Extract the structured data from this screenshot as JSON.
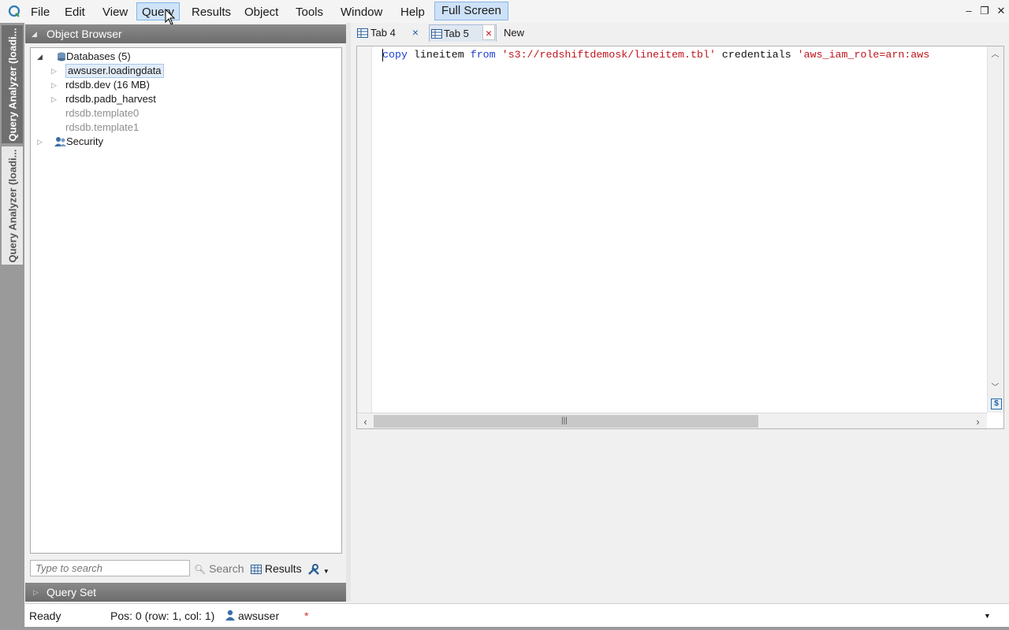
{
  "menu": {
    "items": [
      "File",
      "Edit",
      "View",
      "Query",
      "Results",
      "Object",
      "Tools",
      "Window",
      "Help"
    ],
    "active_index": 3,
    "fullscreen_label": "Full Screen"
  },
  "window_controls": {
    "minimize": "–",
    "restore": "❐",
    "close": "✕"
  },
  "left_tabs": [
    "Query Analyzer (loadi...",
    "Query Analyzer (loadi..."
  ],
  "object_browser": {
    "title": "Object Browser",
    "tree": [
      {
        "label": "Databases (5)",
        "state": "expanded",
        "icon": "database-icon"
      },
      {
        "label": "awsuser.loadingdata",
        "state": "collapsed",
        "selected": true
      },
      {
        "label": "rdsdb.dev (16 MB)",
        "state": "collapsed"
      },
      {
        "label": "rdsdb.padb_harvest",
        "state": "collapsed"
      },
      {
        "label": "rdsdb.template0",
        "state": "none",
        "dim": true
      },
      {
        "label": "rdsdb.template1",
        "state": "none",
        "dim": true
      },
      {
        "label": "Security",
        "state": "collapsed",
        "icon": "users-icon"
      }
    ],
    "search_placeholder": "Type to search",
    "search_label": "Search",
    "results_label": "Results"
  },
  "query_set": {
    "title": "Query Set"
  },
  "tabs": [
    {
      "label": "Tab 4",
      "close": "×"
    },
    {
      "label": "Tab 5",
      "close": "×",
      "active": true
    },
    {
      "label": "New"
    }
  ],
  "editor": {
    "code_tokens": [
      {
        "t": "copy",
        "c": "kw"
      },
      {
        "t": " lineitem ",
        "c": ""
      },
      {
        "t": "from",
        "c": "kw"
      },
      {
        "t": " ",
        "c": ""
      },
      {
        "t": "'s3://redshiftdemosk/lineitem.tbl'",
        "c": "str"
      },
      {
        "t": " credentials ",
        "c": ""
      },
      {
        "t": "'aws_iam_role=arn:aws",
        "c": "str"
      }
    ]
  },
  "status": {
    "state": "Ready",
    "position": "Pos: 0 (row: 1, col: 1)",
    "user": "awsuser",
    "modified": "*"
  },
  "colors": {
    "keyword": "#1f3fcf",
    "string": "#c0141c",
    "accent": "#cde1f7"
  }
}
